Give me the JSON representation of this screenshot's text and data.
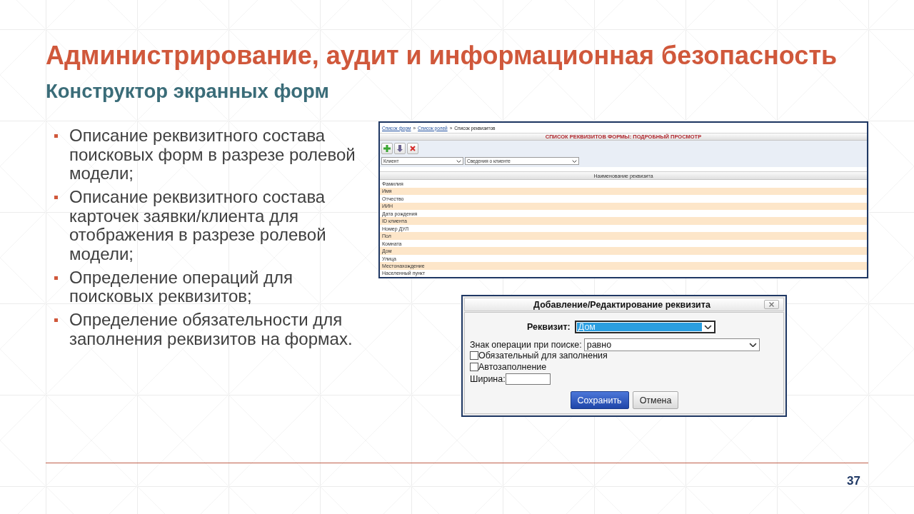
{
  "slide": {
    "title": "Администрирование, аудит и информационная безопасность",
    "subtitle": "Конструктор экранных форм",
    "page_number": "37"
  },
  "bullets": [
    "Описание реквизитного состава поисковых форм в разрезе ролевой модели;",
    "Описание реквизитного состава карточек заявки/клиента для отображения в разрезе ролевой модели;",
    "Определение операций для поисковых реквизитов;",
    "Определение обязательности для заполнения реквизитов на формах."
  ],
  "form_screenshot": {
    "breadcrumbs": [
      {
        "label": "Список форм",
        "kind": "link",
        "separator": "»"
      },
      {
        "label": "Список ролей",
        "kind": "link",
        "separator": "»"
      },
      {
        "label": "Список реквизитов",
        "kind": "current"
      }
    ],
    "header": "СПИСОК РЕКВИЗИТОВ ФОРМЫ: ПОДРОБНЫЙ ПРОСМОТР",
    "toolbar_buttons": [
      {
        "kind": "add"
      },
      {
        "kind": "down"
      },
      {
        "kind": "delete"
      }
    ],
    "filters": [
      {
        "value": "Клиент"
      },
      {
        "value": "Сведения о клиенте"
      }
    ],
    "table": {
      "columns": [
        "Наименование реквизита"
      ],
      "rows": [
        "Фамилия",
        "Имя",
        "Отчество",
        "ИИН",
        "Дата рождения",
        "ID клиента",
        "Номер ДУЛ",
        "Пол",
        "Комната",
        "Дом",
        "Улица",
        "Местонахождение",
        "Населенный пункт"
      ]
    }
  },
  "dialog": {
    "title": "Добавление/Редактирование реквизита",
    "attribute": {
      "label": "Реквизит:",
      "value": "Дом",
      "highlighted": true
    },
    "operation": {
      "label": "Знак операции при поиске:",
      "value": "равно"
    },
    "options": [
      {
        "label": "Обязательный для заполнения",
        "checked": false
      },
      {
        "label": "Автозаполнение",
        "checked": false
      }
    ],
    "width": {
      "label": "Ширина:"
    },
    "buttons": [
      {
        "label": "Сохранить",
        "kind": "primary"
      },
      {
        "label": "Отмена",
        "kind": "secondary"
      }
    ]
  }
}
